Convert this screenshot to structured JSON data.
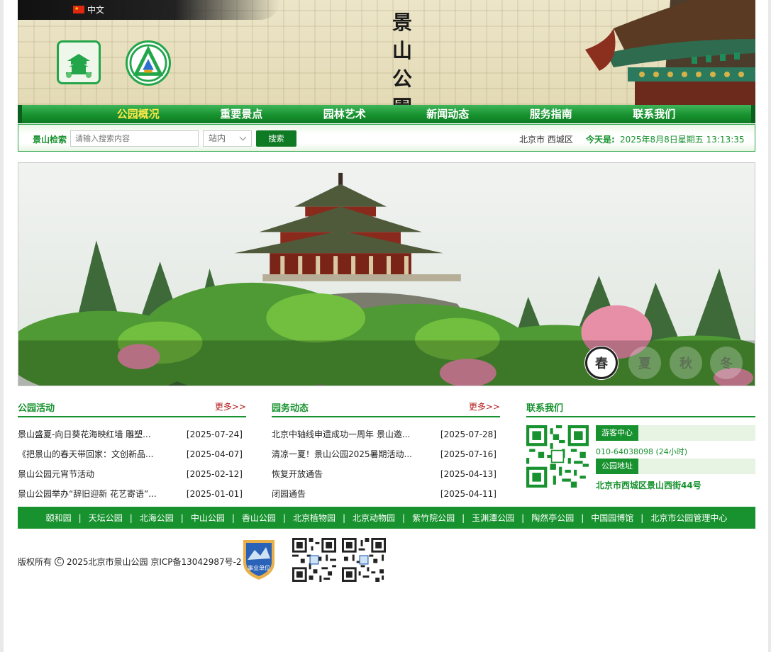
{
  "header": {
    "language": "中文",
    "calligraphy": [
      "景",
      "山",
      "公",
      "園"
    ],
    "icons": {
      "flag": "china-flag-icon",
      "logo_park": "jingshan-park-logo-icon",
      "logo_org": "park-emblem-logo-icon"
    }
  },
  "nav": {
    "items": [
      "公园概况",
      "重要景点",
      "园林艺术",
      "新闻动态",
      "服务指南",
      "联系我们"
    ],
    "active_index": 0
  },
  "search": {
    "label": "景山检索",
    "placeholder": "请输入搜索内容",
    "scope_selected": "站内",
    "button": "搜索",
    "location": "北京市 西城区",
    "today_label": "今天是:",
    "today_value": "2025年8月8日星期五 13:13:35"
  },
  "hero": {
    "seasons": [
      "春",
      "夏",
      "秋",
      "冬"
    ],
    "active_season_index": 0
  },
  "activities": {
    "title": "公园活动",
    "more": "更多>>",
    "items": [
      {
        "title": "景山盛夏-向日葵花海映红墙 雕塑...",
        "date": "[2025-07-24]"
      },
      {
        "title": "《把景山的春天带回家：文创新品...",
        "date": "[2025-04-07]"
      },
      {
        "title": "景山公园元宵节活动",
        "date": "[2025-02-12]"
      },
      {
        "title": "景山公园举办“辞旧迎新 花艺寄语”...",
        "date": "[2025-01-01]"
      }
    ]
  },
  "affairs": {
    "title": "园务动态",
    "more": "更多>>",
    "items": [
      {
        "title": "北京中轴线申遗成功一周年 景山邀...",
        "date": "[2025-07-28]"
      },
      {
        "title": "清凉一夏！景山公园2025暑期活动...",
        "date": "[2025-07-16]"
      },
      {
        "title": "恢复开放通告",
        "date": "[2025-04-13]"
      },
      {
        "title": "闭园通告",
        "date": "[2025-04-11]"
      }
    ]
  },
  "contact": {
    "title": "联系我们",
    "visitor_center_label": "游客中心",
    "visitor_center_phone": "010-64038098 (24小时)",
    "address_label": "公园地址",
    "address": "北京市西城区景山西街44号"
  },
  "footer_links": [
    "颐和园",
    "天坛公园",
    "北海公园",
    "中山公园",
    "香山公园",
    "北京植物园",
    "北京动物园",
    "紫竹院公园",
    "玉渊潭公园",
    "陶然亭公园",
    "中国园博馆",
    "北京市公园管理中心"
  ],
  "footer": {
    "copyright": "版权所有",
    "copyright_text": "2025北京市景山公园 京ICP备13042987号-2",
    "badge": "事业单位"
  },
  "colors": {
    "primary_green": "#17922e",
    "more_red": "#b51b1b",
    "nav_active": "#ffe84a"
  }
}
